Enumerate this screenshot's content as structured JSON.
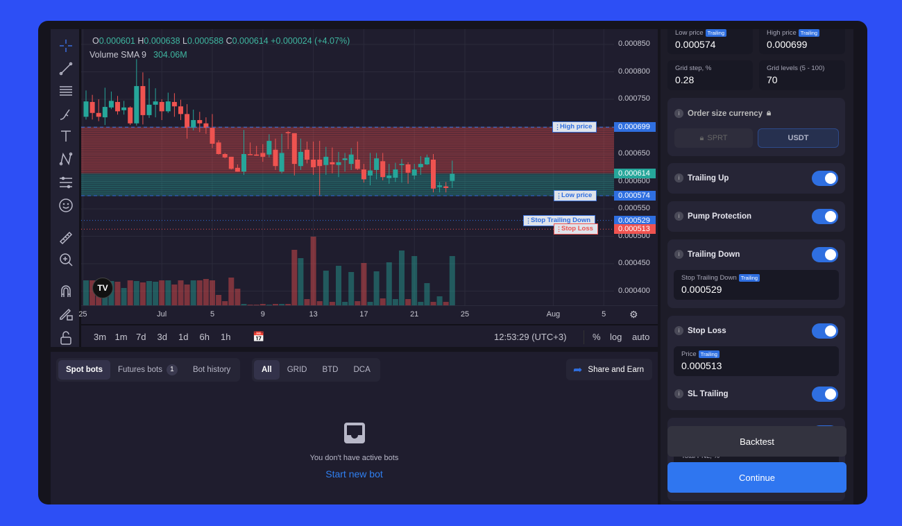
{
  "ohlc": {
    "o_label": "O",
    "o": "0.000601",
    "h_label": "H",
    "h": "0.000638",
    "l_label": "L",
    "l": "0.000588",
    "c_label": "C",
    "c": "0.000614",
    "change": "+0.000024 (+4.07%)"
  },
  "volume_sma": {
    "label": "Volume SMA 9",
    "value": "304.06M"
  },
  "logo_text": "TV",
  "colors": {
    "up": "#26a69a",
    "down": "#ef5350",
    "accent": "#2f6fe0",
    "background": "#1f1d2e"
  },
  "toolbar_icons": [
    "crosshair-icon",
    "trend-line-icon",
    "fib-icon",
    "brush-icon",
    "text-icon",
    "pattern-icon",
    "forecast-icon",
    "emoji-icon",
    "ruler-icon",
    "zoom-in-icon",
    "magnet-icon",
    "lock-drawings-icon",
    "unlock-icon"
  ],
  "chart_data": {
    "type": "candlestick",
    "price_unit": "0.000001",
    "y_ticks": [
      "0.000850",
      "0.000800",
      "0.000750",
      "0.000700",
      "0.000650",
      "0.000600",
      "0.000550",
      "0.000500",
      "0.000450",
      "0.000400"
    ],
    "ylim": [
      0.000393,
      0.000867
    ],
    "x_ticks": [
      {
        "label": "25",
        "index": -0.5
      },
      {
        "label": "Jul",
        "index": 12
      },
      {
        "label": "5",
        "index": 20
      },
      {
        "label": "9",
        "index": 28
      },
      {
        "label": "13",
        "index": 36
      },
      {
        "label": "17",
        "index": 44
      },
      {
        "label": "21",
        "index": 52
      },
      {
        "label": "25",
        "index": 60
      },
      {
        "label": "Aug",
        "index": 74
      },
      {
        "label": "5",
        "index": 82
      }
    ],
    "candles": [
      [
        718,
        766,
        713,
        746
      ],
      [
        745,
        758,
        713,
        725
      ],
      [
        725,
        750,
        710,
        718
      ],
      [
        717,
        771,
        703,
        736
      ],
      [
        735,
        764,
        732,
        747
      ],
      [
        745,
        756,
        722,
        728
      ],
      [
        730,
        747,
        722,
        735
      ],
      [
        735,
        737,
        703,
        706
      ],
      [
        706,
        823,
        702,
        774
      ],
      [
        774,
        799,
        704,
        721
      ],
      [
        721,
        788,
        716,
        740
      ],
      [
        740,
        770,
        717,
        746
      ],
      [
        745,
        750,
        712,
        728
      ],
      [
        728,
        762,
        725,
        746
      ],
      [
        745,
        761,
        718,
        737
      ],
      [
        737,
        749,
        712,
        723
      ],
      [
        723,
        741,
        678,
        698
      ],
      [
        698,
        731,
        693,
        712
      ],
      [
        712,
        727,
        690,
        706
      ],
      [
        706,
        717,
        687,
        698
      ],
      [
        698,
        723,
        661,
        669
      ],
      [
        671,
        675,
        649,
        650
      ],
      [
        650,
        652,
        642,
        644
      ],
      [
        645,
        645,
        622,
        623
      ],
      [
        625,
        631,
        618,
        618
      ],
      [
        618,
        694,
        612,
        650
      ],
      [
        650,
        671,
        648,
        649
      ],
      [
        649,
        665,
        647,
        648
      ],
      [
        652,
        668,
        636,
        645
      ],
      [
        649,
        686,
        644,
        674
      ],
      [
        658,
        678,
        621,
        628
      ],
      [
        618,
        687,
        615,
        652
      ],
      [
        690,
        692,
        659,
        688
      ],
      [
        688,
        688,
        611,
        632
      ],
      [
        628,
        678,
        621,
        654
      ],
      [
        658,
        673,
        633,
        640
      ],
      [
        640,
        673,
        612,
        626
      ],
      [
        640,
        674,
        574,
        628
      ],
      [
        630,
        663,
        612,
        645
      ],
      [
        635,
        662,
        615,
        631
      ],
      [
        630,
        654,
        608,
        635
      ],
      [
        639,
        652,
        618,
        642
      ],
      [
        632,
        661,
        621,
        649
      ],
      [
        640,
        673,
        621,
        623
      ],
      [
        622,
        632,
        598,
        604
      ],
      [
        611,
        652,
        593,
        620
      ],
      [
        621,
        652,
        604,
        642
      ],
      [
        637,
        652,
        602,
        608
      ],
      [
        606,
        632,
        596,
        611
      ],
      [
        607,
        634,
        599,
        622
      ],
      [
        630,
        641,
        598,
        632
      ],
      [
        631,
        635,
        596,
        616
      ],
      [
        611,
        632,
        604,
        622
      ],
      [
        626,
        646,
        612,
        632
      ],
      [
        631,
        649,
        630,
        644
      ],
      [
        640,
        650,
        580,
        587
      ],
      [
        590,
        599,
        580,
        593
      ],
      [
        591,
        599,
        580,
        588
      ],
      [
        601,
        638,
        588,
        614
      ]
    ],
    "volumes": [
      360,
      360,
      280,
      350,
      350,
      340,
      250,
      360,
      350,
      330,
      350,
      340,
      360,
      360,
      300,
      360,
      300,
      360,
      360,
      380,
      360,
      150,
      60,
      400,
      240,
      20,
      10,
      10,
      20,
      10,
      20,
      20,
      20,
      800,
      680,
      90,
      990,
      60,
      500,
      50,
      570,
      50,
      480,
      60,
      610,
      50,
      490,
      100,
      620,
      90,
      790,
      90,
      710,
      50,
      320,
      50,
      130,
      50,
      710
    ],
    "grid": {
      "low": 0.000574,
      "high": 0.000699,
      "current": 0.000614,
      "levels": 70
    },
    "price_lines": [
      {
        "label": "High price",
        "value": "0.000699",
        "color": "#2f6fe0"
      },
      {
        "label": "Low price",
        "value": "0.000574",
        "color": "#2f6fe0"
      },
      {
        "label": "Stop Trailing Down",
        "value": "0.000529",
        "color": "#2f6fe0"
      },
      {
        "label": "Stop Loss",
        "value": "0.000513",
        "color": "#ef5350"
      }
    ],
    "current_price": "0.000614"
  },
  "timeframes": [
    "3m",
    "1m",
    "7d",
    "3d",
    "1d",
    "6h",
    "1h"
  ],
  "clock": "12:53:29 (UTC+3)",
  "scale_opts": [
    "%",
    "log",
    "auto"
  ],
  "bots": {
    "tabs": [
      {
        "label": "Spot bots"
      },
      {
        "label": "Futures bots",
        "badge": "1"
      },
      {
        "label": "Bot history"
      }
    ],
    "filters": [
      "All",
      "GRID",
      "BTD",
      "DCA"
    ],
    "share": "Share and Earn",
    "empty_text": "You don't have active bots",
    "start_link": "Start new bot"
  },
  "right": {
    "low_price": {
      "label": "Low price",
      "tag": "Trailing",
      "value": "0.000574"
    },
    "high_price": {
      "label": "High price",
      "tag": "Trailing",
      "value": "0.000699"
    },
    "grid_step": {
      "label": "Grid step, %",
      "value": "0.28"
    },
    "grid_levels": {
      "label": "Grid levels (5 - 100)",
      "value": "70"
    },
    "order_currency": {
      "label": "Order size currency",
      "options": [
        "SPRT",
        "USDT"
      ],
      "selected": "USDT"
    },
    "trailing_up": {
      "label": "Trailing Up",
      "on": true
    },
    "pump_protection": {
      "label": "Pump Protection",
      "on": true
    },
    "trailing_down": {
      "label": "Trailing Down",
      "on": true,
      "field_label": "Stop Trailing Down",
      "tag": "Trailing",
      "value": "0.000529"
    },
    "stop_loss": {
      "label": "Stop Loss",
      "on": true,
      "field_label": "Price",
      "tag": "Trailing",
      "value": "0.000513"
    },
    "sl_trailing": {
      "label": "SL Trailing",
      "on": true
    },
    "total_pnl_label": "Total PNL, %",
    "backtest": "Backtest",
    "continue": "Continue"
  }
}
